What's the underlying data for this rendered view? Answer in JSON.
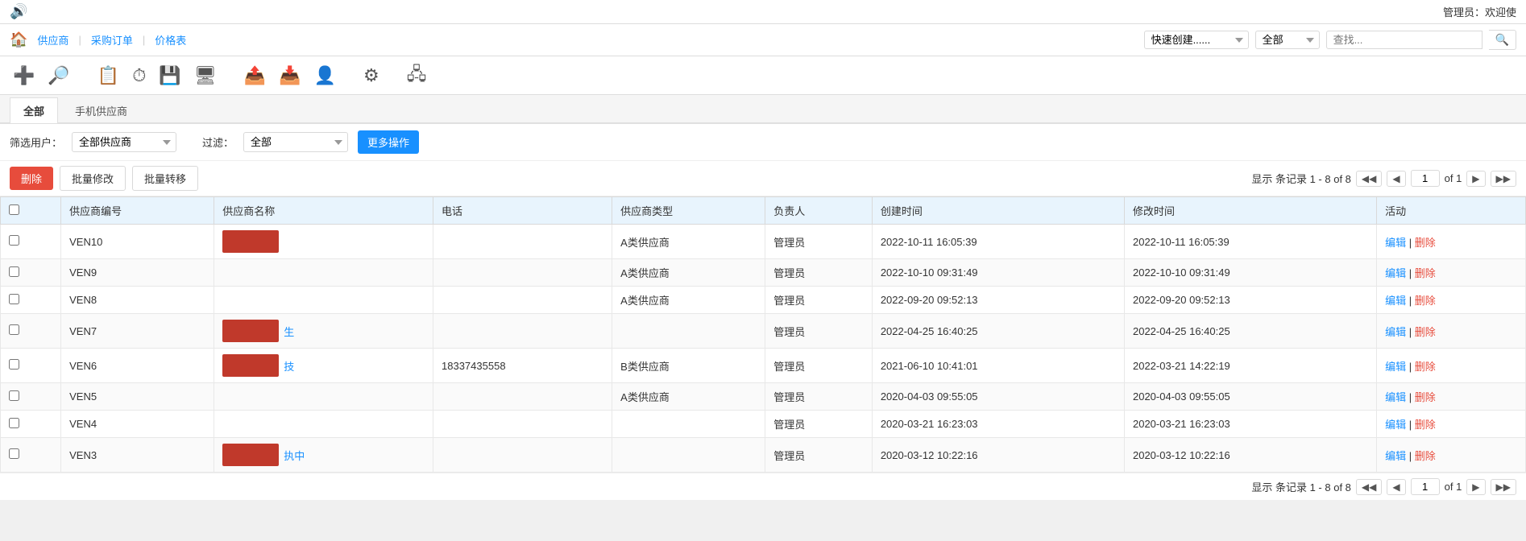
{
  "topbar": {
    "speaker_icon": "🔊",
    "admin_text": "管理员：欢迎使"
  },
  "navbar": {
    "home_icon": "🏠",
    "links": [
      "供应商",
      "采购订单",
      "价格表"
    ],
    "divider": "|",
    "quick_create_placeholder": "快速创建......",
    "filter_options": [
      "全部"
    ],
    "filter_default": "全部",
    "search_placeholder": "查找...",
    "search_icon": "🔍"
  },
  "toolbar": {
    "icons": [
      {
        "name": "add-icon",
        "symbol": "➕"
      },
      {
        "name": "search-icon",
        "symbol": "🔍"
      },
      {
        "name": "calendar-icon",
        "symbol": "📅"
      },
      {
        "name": "clock-icon",
        "symbol": "🕐"
      },
      {
        "name": "save-icon",
        "symbol": "💾"
      },
      {
        "name": "monitor-icon",
        "symbol": "🖥"
      },
      {
        "name": "upload-icon",
        "symbol": "📤"
      },
      {
        "name": "download-icon",
        "symbol": "📥"
      },
      {
        "name": "user-icon",
        "symbol": "👤"
      },
      {
        "name": "settings-icon",
        "symbol": "⚙"
      },
      {
        "name": "network-icon",
        "symbol": "🖧"
      }
    ]
  },
  "tabs": [
    {
      "label": "全部",
      "active": true
    },
    {
      "label": "手机供应商",
      "active": false
    }
  ],
  "filter": {
    "user_label": "筛选用户：",
    "user_default": "全部供应商",
    "user_options": [
      "全部供应商"
    ],
    "filter_label": "过滤：",
    "filter_default": "全部",
    "filter_options": [
      "全部"
    ],
    "more_ops_label": "更多操作"
  },
  "actions": {
    "delete_label": "删除",
    "batch_edit_label": "批量修改",
    "batch_transfer_label": "批量转移"
  },
  "pagination": {
    "display_text": "显示 条记录 1 - 8 of 8",
    "page_value": "1",
    "of_text": "of 1"
  },
  "table": {
    "columns": [
      "",
      "供应商编号",
      "供应商名称",
      "电话",
      "供应商类型",
      "负责人",
      "创建时间",
      "修改时间",
      "活动"
    ],
    "rows": [
      {
        "id": "VEN10",
        "name": "",
        "name_has_red": true,
        "name_red_text": "",
        "phone": "",
        "type": "A类供应商",
        "owner": "管理员",
        "created": "2022-10-11 16:05:39",
        "modified": "2022-10-11 16:05:39",
        "edit_label": "编辑",
        "delete_label": "删除"
      },
      {
        "id": "VEN9",
        "name": "",
        "name_has_red": false,
        "name_red_text": "",
        "phone": "",
        "type": "A类供应商",
        "owner": "管理员",
        "created": "2022-10-10 09:31:49",
        "modified": "2022-10-10 09:31:49",
        "edit_label": "编辑",
        "delete_label": "删除"
      },
      {
        "id": "VEN8",
        "name": "",
        "name_has_red": false,
        "name_red_text": "",
        "phone": "",
        "type": "A类供应商",
        "owner": "管理员",
        "created": "2022-09-20 09:52:13",
        "modified": "2022-09-20 09:52:13",
        "edit_label": "编辑",
        "delete_label": "删除"
      },
      {
        "id": "VEN7",
        "name": "生",
        "name_has_red": true,
        "name_red_text": "生",
        "phone": "",
        "type": "",
        "owner": "管理员",
        "created": "2022-04-25 16:40:25",
        "modified": "2022-04-25 16:40:25",
        "edit_label": "编辑",
        "delete_label": "删除"
      },
      {
        "id": "VEN6",
        "name": "技",
        "name_has_red": true,
        "name_red_text": "技",
        "phone": "18337435558",
        "type": "B类供应商",
        "owner": "管理员",
        "created": "2021-06-10 10:41:01",
        "modified": "2022-03-21 14:22:19",
        "edit_label": "编辑",
        "delete_label": "删除"
      },
      {
        "id": "VEN5",
        "name": "",
        "name_has_red": false,
        "name_red_text": "",
        "phone": "",
        "type": "A类供应商",
        "owner": "管理员",
        "created": "2020-04-03 09:55:05",
        "modified": "2020-04-03 09:55:05",
        "edit_label": "编辑",
        "delete_label": "删除"
      },
      {
        "id": "VEN4",
        "name": "",
        "name_has_red": false,
        "name_red_text": "",
        "phone": "",
        "type": "",
        "owner": "管理员",
        "created": "2020-03-21 16:23:03",
        "modified": "2020-03-21 16:23:03",
        "edit_label": "编辑",
        "delete_label": "删除"
      },
      {
        "id": "VEN3",
        "name": "执中",
        "name_has_red": true,
        "name_red_text": "执中",
        "phone": "",
        "type": "",
        "owner": "管理员",
        "created": "2020-03-12 10:22:16",
        "modified": "2020-03-12 10:22:16",
        "edit_label": "编辑",
        "delete_label": "删除"
      }
    ]
  },
  "bottom_pagination": {
    "display_text": "显示 条记录 1 - 8 of 8",
    "page_value": "1",
    "of_text": "of 1"
  }
}
